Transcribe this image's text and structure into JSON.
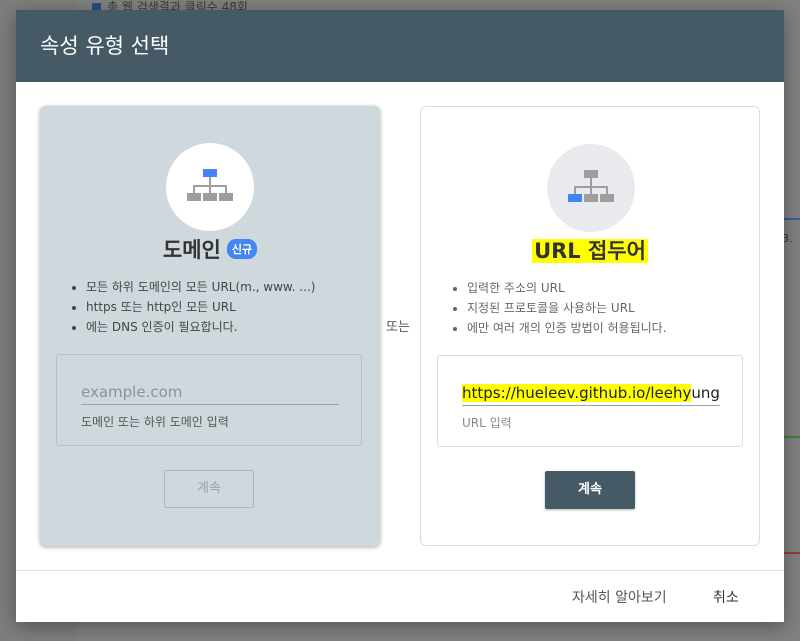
{
  "background": {
    "top_text": "총 웹 검색결과 클릭수 48회",
    "side_text": "3."
  },
  "dialog": {
    "title": "속성 유형 선택",
    "or_label": "또는"
  },
  "domain_card": {
    "title": "도메인",
    "badge": "신규",
    "bullets": [
      "모든 하위 도메인의 모든 URL(m., www. ...)",
      "https 또는 http인 모든 URL",
      "에는 DNS 인증이 필요합니다."
    ],
    "input_placeholder": "example.com",
    "input_help": "도메인 또는 하위 도메인 입력",
    "button_label": "계속",
    "icon": "sitemap-icon"
  },
  "url_card": {
    "title": "URL 접두어",
    "bullets": [
      "입력한 주소의 URL",
      "지정된 프로토콜을 사용하는 URL",
      "에만 여러 개의 인증 방법이 허용됩니다."
    ],
    "input_value_highlighted": "https://hueleev.github.io/leehy",
    "input_value_rest": "ung",
    "input_help": "URL 입력",
    "button_label": "계속",
    "icon": "sitemap-icon"
  },
  "footer": {
    "learn_more": "자세히 알아보기",
    "cancel": "취소"
  },
  "colors": {
    "header": "#455a64",
    "domain_card_bg": "#cfd8dc",
    "accent_blue": "#4285f4",
    "highlight": "#ffff00"
  }
}
